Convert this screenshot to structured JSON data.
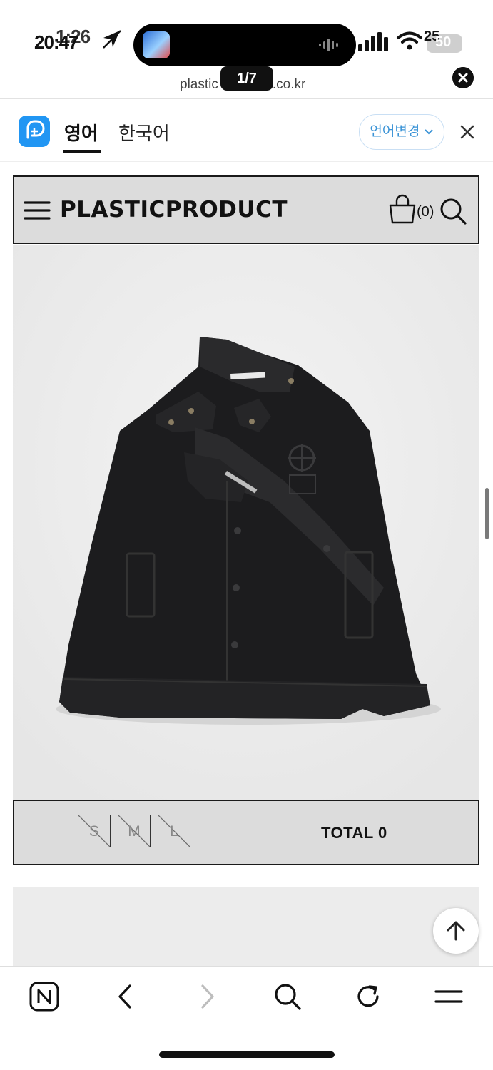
{
  "status_bar": {
    "time_primary": "20:47",
    "time_overlay": "1:26",
    "battery_label": "50",
    "battery_overlay": "25"
  },
  "url_bar": {
    "url": "plastic    .co.kr",
    "page_counter": "1/7"
  },
  "translate_bar": {
    "tab_english": "영어",
    "tab_korean": "한국어",
    "language_change": "언어변경"
  },
  "site": {
    "logo": "PLASTICPRODUCT",
    "cart_count": "(0)"
  },
  "sizes": [
    "S",
    "M",
    "L"
  ],
  "total_label": "TOTAL 0",
  "icons": {
    "menu": "hamburger-menu-icon",
    "bag": "shopping-bag-icon",
    "search": "search-icon",
    "scroll_top": "arrow-up-icon",
    "toolbar": [
      "naver-home-icon",
      "back-icon",
      "forward-icon",
      "search-icon",
      "reload-icon",
      "menu-icon"
    ]
  },
  "colors": {
    "accent": "#2196f3",
    "header_bg": "#dcdcdc",
    "product_bg": "#ececec",
    "jacket": "#1c1c1e"
  }
}
